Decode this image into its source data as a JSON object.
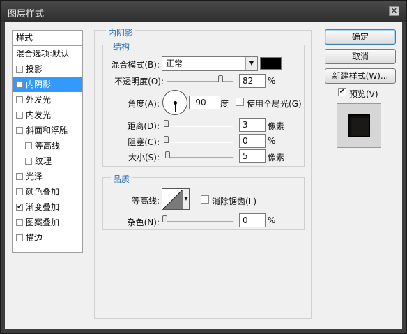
{
  "window": {
    "title": "图层样式",
    "close_glyph": "✕"
  },
  "style_list": {
    "header": "样式",
    "blend_options": "混合选项:默认",
    "items": [
      {
        "label": "投影",
        "checked": false,
        "sub": false,
        "selected": false
      },
      {
        "label": "内阴影",
        "checked": true,
        "sub": false,
        "selected": true
      },
      {
        "label": "外发光",
        "checked": false,
        "sub": false,
        "selected": false
      },
      {
        "label": "内发光",
        "checked": false,
        "sub": false,
        "selected": false
      },
      {
        "label": "斜面和浮雕",
        "checked": false,
        "sub": false,
        "selected": false
      },
      {
        "label": "等高线",
        "checked": false,
        "sub": true,
        "selected": false
      },
      {
        "label": "纹理",
        "checked": false,
        "sub": true,
        "selected": false
      },
      {
        "label": "光泽",
        "checked": false,
        "sub": false,
        "selected": false
      },
      {
        "label": "颜色叠加",
        "checked": false,
        "sub": false,
        "selected": false
      },
      {
        "label": "渐变叠加",
        "checked": true,
        "sub": false,
        "selected": false
      },
      {
        "label": "图案叠加",
        "checked": false,
        "sub": false,
        "selected": false
      },
      {
        "label": "描边",
        "checked": false,
        "sub": false,
        "selected": false
      }
    ]
  },
  "panel": {
    "title": "内阴影",
    "structure": {
      "legend": "结构",
      "blend_mode_label": "混合模式(B):",
      "blend_mode_value": "正常",
      "blend_color": "#000000",
      "opacity_label": "不透明度(O):",
      "opacity_value": "82",
      "opacity_unit": "%",
      "angle_label": "角度(A):",
      "angle_value": "-90",
      "angle_unit": "度",
      "global_light_label": "使用全局光(G)",
      "global_light_checked": false,
      "distance_label": "距离(D):",
      "distance_value": "3",
      "distance_unit": "像素",
      "choke_label": "阻塞(C):",
      "choke_value": "0",
      "choke_unit": "%",
      "size_label": "大小(S):",
      "size_value": "5",
      "size_unit": "像素"
    },
    "quality": {
      "legend": "品质",
      "contour_label": "等高线:",
      "anti_alias_label": "消除锯齿(L)",
      "anti_alias_checked": false,
      "noise_label": "杂色(N):",
      "noise_value": "0",
      "noise_unit": "%"
    }
  },
  "buttons": {
    "ok": "确定",
    "cancel": "取消",
    "new_style": "新建样式(W)...",
    "preview_label": "预览(V)",
    "preview_checked": true
  }
}
